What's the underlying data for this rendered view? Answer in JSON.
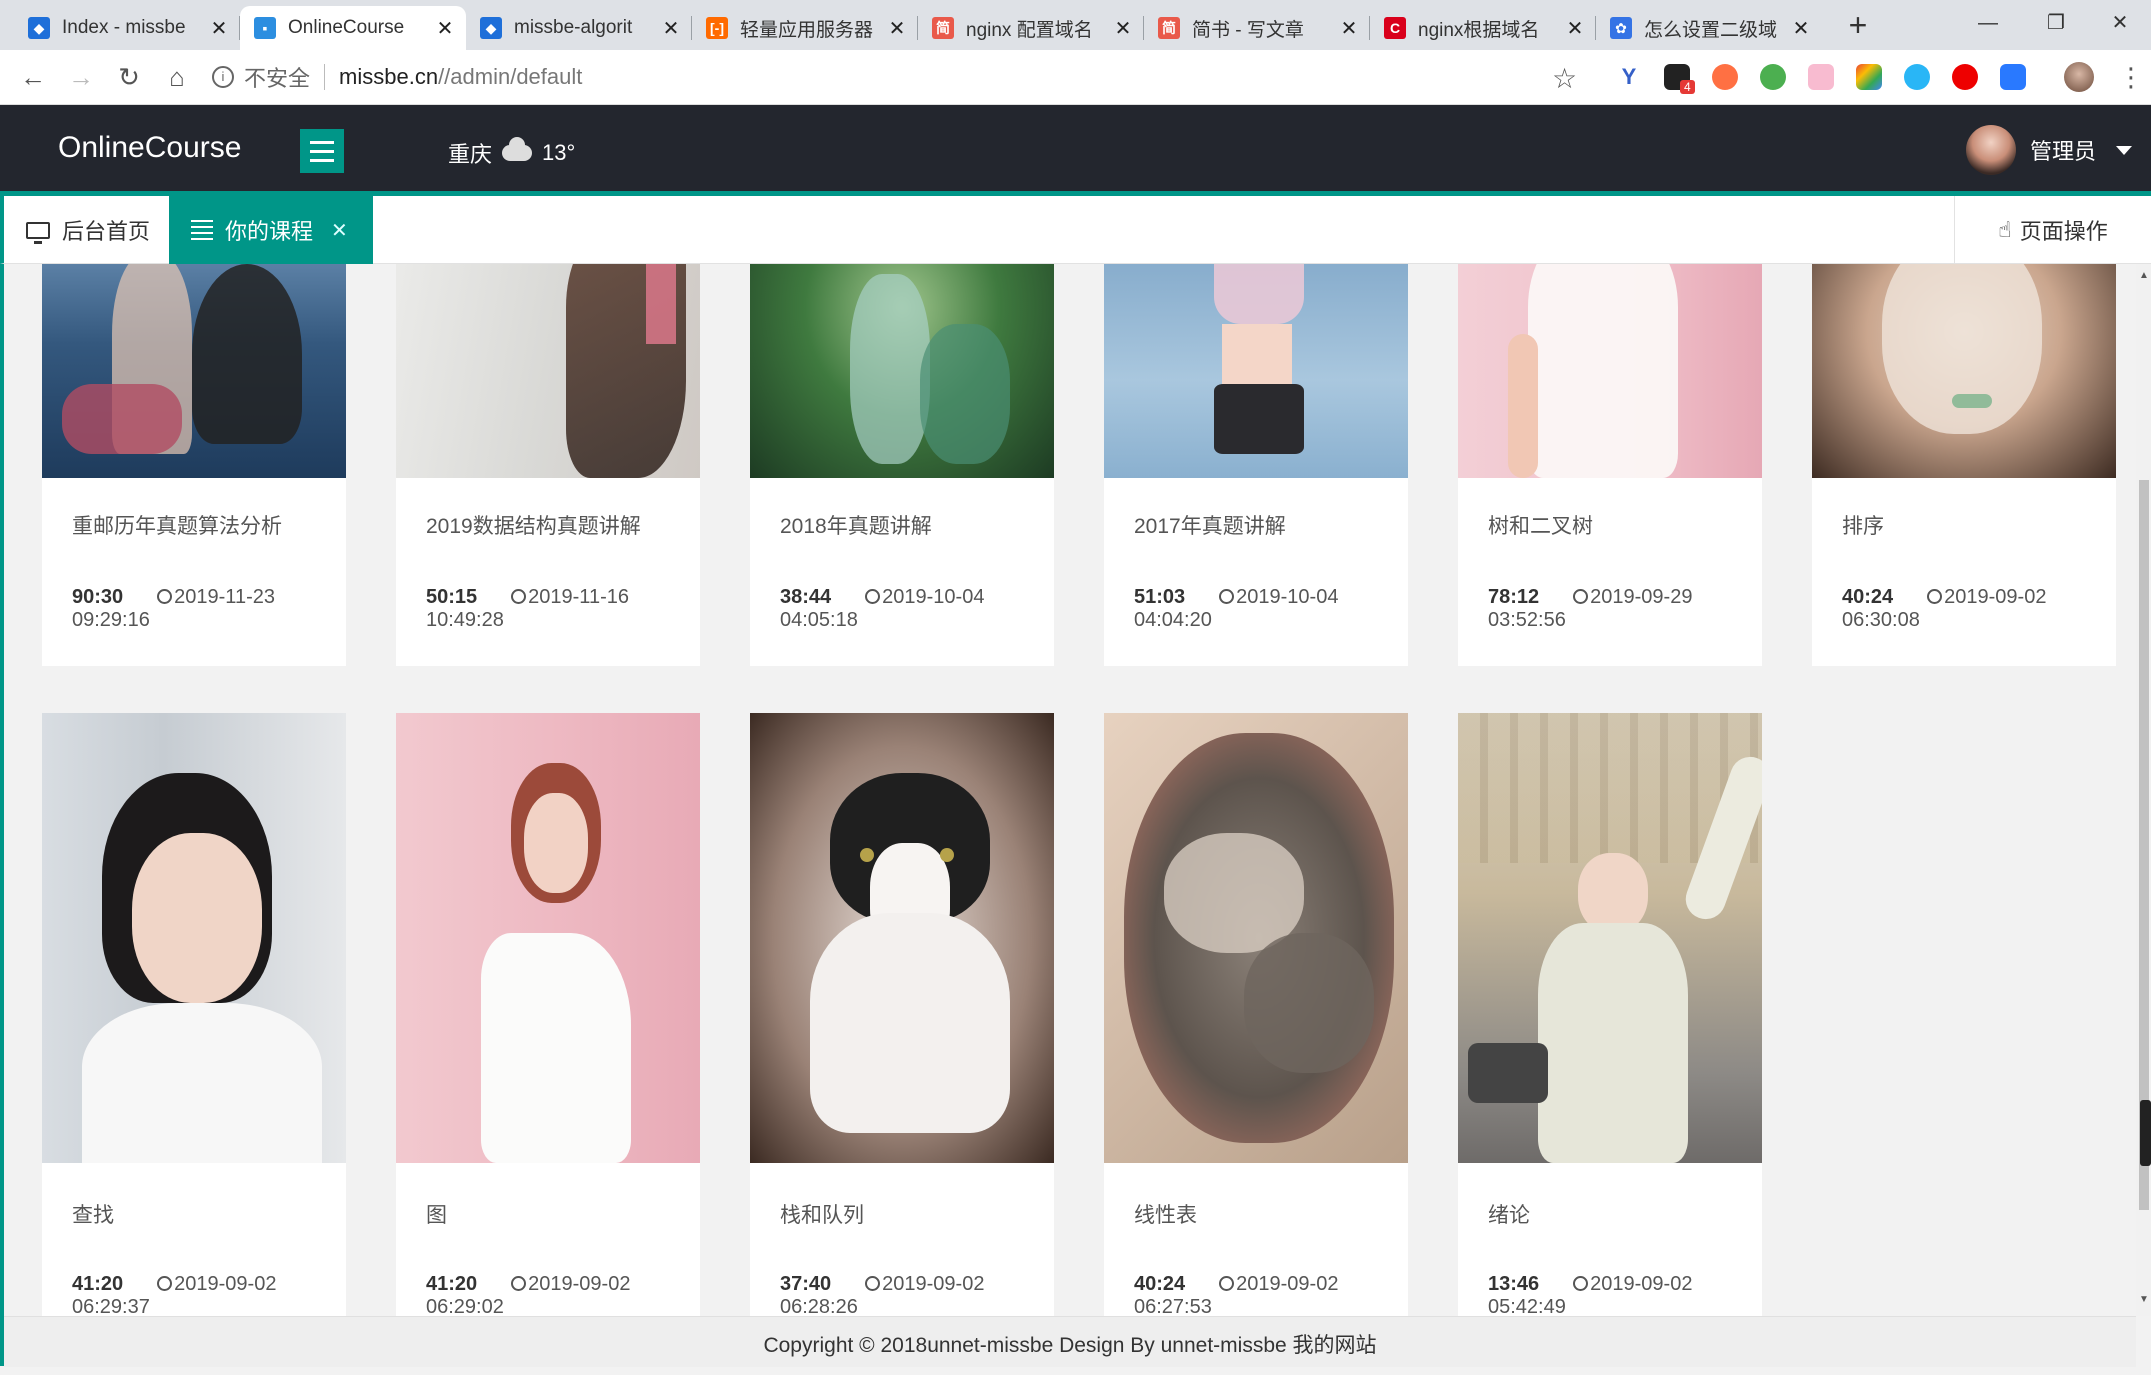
{
  "browser": {
    "tabs": [
      {
        "title": "Index - missbe",
        "icon": "vs-icon",
        "color": "#1e6fd9"
      },
      {
        "title": "OnlineCourse",
        "icon": "layui-icon",
        "color": "#2c8ee0"
      },
      {
        "title": "missbe-algorit",
        "icon": "vs-icon",
        "color": "#1e6fd9"
      },
      {
        "title": "轻量应用服务器",
        "icon": "aliyun-icon",
        "color": "#ff6a00"
      },
      {
        "title": "nginx 配置域名",
        "icon": "jianshu-icon",
        "color": "#e9594a"
      },
      {
        "title": "简书 - 写文章",
        "icon": "jianshu-icon",
        "color": "#e9594a"
      },
      {
        "title": "nginx根据域名",
        "icon": "csdn-icon",
        "color": "#d9001b"
      },
      {
        "title": "怎么设置二级域",
        "icon": "baidu-icon",
        "color": "#3473e5"
      }
    ],
    "url_insecure": "不安全",
    "url_host": "missbe.cn",
    "url_path": "//admin/default",
    "ext_badge": "4"
  },
  "app": {
    "logo": "OnlineCourse",
    "city": "重庆",
    "temperature": "13°",
    "username": "管理员",
    "accent": "#009688",
    "header_bg": "#23262e"
  },
  "pagetabs": {
    "home": "后台首页",
    "current": "你的课程",
    "page_ops": "页面操作"
  },
  "courses": [
    {
      "title": "重邮历年真题算法分析",
      "duration": "90:30",
      "date": "2019-11-23",
      "time": "09:29:16"
    },
    {
      "title": "2019数据结构真题讲解",
      "duration": "50:15",
      "date": "2019-11-16",
      "time": "10:49:28"
    },
    {
      "title": "2018年真题讲解",
      "duration": "38:44",
      "date": "2019-10-04",
      "time": "04:05:18"
    },
    {
      "title": "2017年真题讲解",
      "duration": "51:03",
      "date": "2019-10-04",
      "time": "04:04:20"
    },
    {
      "title": "树和二叉树",
      "duration": "78:12",
      "date": "2019-09-29",
      "time": "03:52:56"
    },
    {
      "title": "排序",
      "duration": "40:24",
      "date": "2019-09-02",
      "time": "06:30:08"
    },
    {
      "title": "查找",
      "duration": "41:20",
      "date": "2019-09-02",
      "time": "06:29:37"
    },
    {
      "title": "图",
      "duration": "41:20",
      "date": "2019-09-02",
      "time": "06:29:02"
    },
    {
      "title": "栈和队列",
      "duration": "37:40",
      "date": "2019-09-02",
      "time": "06:28:26"
    },
    {
      "title": "线性表",
      "duration": "40:24",
      "date": "2019-09-02",
      "time": "06:27:53"
    },
    {
      "title": "绪论",
      "duration": "13:46",
      "date": "2019-09-02",
      "time": "05:42:49"
    }
  ],
  "footer": "Copyright © 2018unnet-missbe Design By unnet-missbe 我的网站"
}
